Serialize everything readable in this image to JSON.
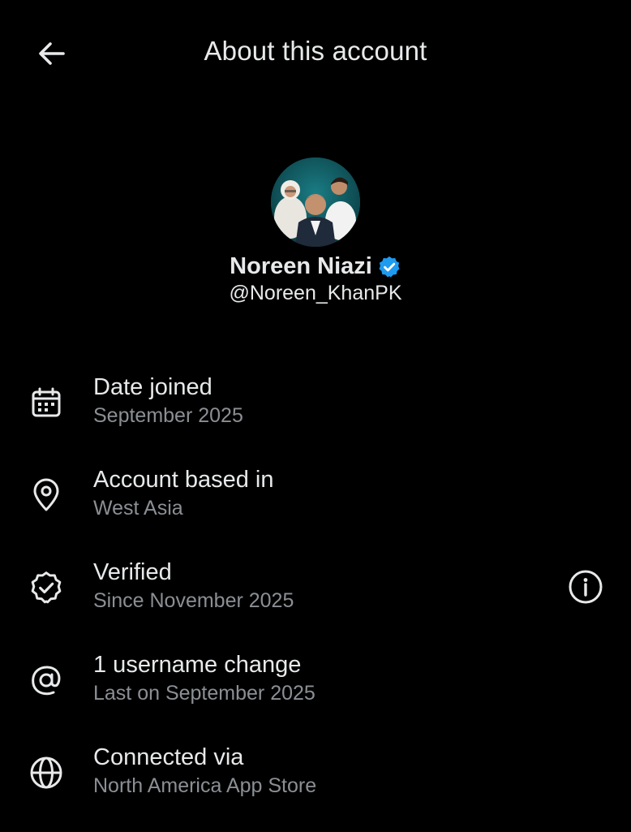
{
  "header": {
    "title": "About this account",
    "back_icon": "arrow-left-icon"
  },
  "profile": {
    "display_name": "Noreen Niazi",
    "handle": "@Noreen_KhanPK",
    "verified_badge_color": "#1d9bf0",
    "avatar_background": "#0e4f55"
  },
  "details": [
    {
      "icon": "calendar-icon",
      "title": "Date joined",
      "subtitle": "September 2025"
    },
    {
      "icon": "location-pin-icon",
      "title": "Account based in",
      "subtitle": "West Asia"
    },
    {
      "icon": "verified-badge-outline-icon",
      "title": "Verified",
      "subtitle": "Since November 2025",
      "action_icon": "info-icon"
    },
    {
      "icon": "at-sign-icon",
      "title": "1 username change",
      "subtitle": "Last on September 2025"
    },
    {
      "icon": "globe-icon",
      "title": "Connected via",
      "subtitle": "North America App Store"
    }
  ],
  "colors": {
    "background": "#000000",
    "primary_text": "#e7e9ea",
    "secondary_text": "#8b8f94",
    "accent": "#1d9bf0"
  }
}
